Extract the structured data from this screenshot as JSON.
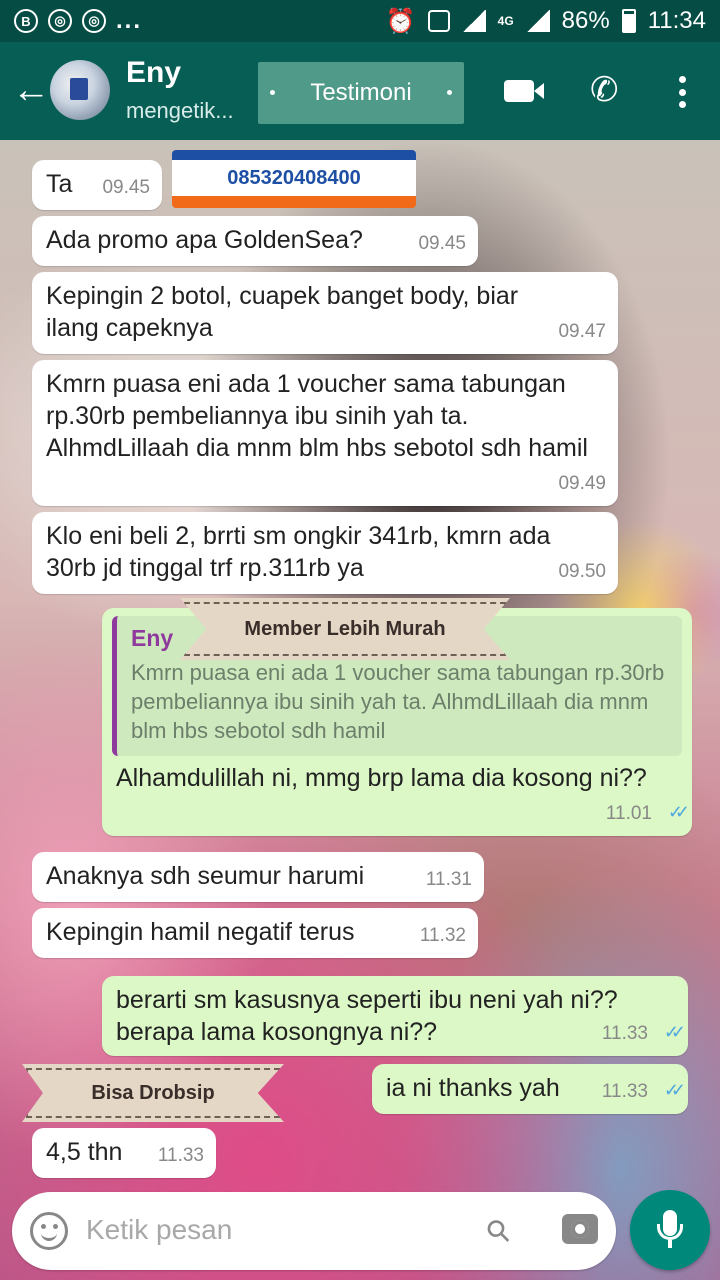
{
  "status_bar": {
    "icons_left": [
      "b-icon",
      "chrome-icon",
      "chrome-icon"
    ],
    "overflow": "...",
    "network": "4G",
    "battery": "86%",
    "time": "11:34"
  },
  "header": {
    "contact_name": "Eny",
    "contact_status": "mengetik...",
    "banner": "Testimoni"
  },
  "overlays": {
    "phone_number": "085320408400",
    "tag_member": "Member Lebih Murah",
    "tag_drobsip": "Bisa Drobsip"
  },
  "messages": [
    {
      "dir": "in",
      "text": "Ta",
      "time": "09.45"
    },
    {
      "dir": "in",
      "text": "Ada promo apa GoldenSea?",
      "time": "09.45"
    },
    {
      "dir": "in",
      "text": "Kepingin 2 botol, cuapek banget body, biar ilang capeknya",
      "time": "09.47"
    },
    {
      "dir": "in",
      "text": "Kmrn puasa eni ada 1 voucher sama tabungan rp.30rb pembeliannya ibu sinih yah ta. AlhmdLillaah dia mnm blm hbs sebotol sdh hamil",
      "time": "09.49"
    },
    {
      "dir": "in",
      "text": "Klo eni beli 2, brrti sm ongkir 341rb, kmrn ada 30rb jd tinggal trf rp.311rb ya",
      "time": "09.50"
    },
    {
      "dir": "out",
      "quote_name": "Eny",
      "quote_text": "Kmrn puasa eni ada 1 voucher sama tabungan rp.30rb pembeliannya ibu sinih yah ta. AlhmdLillaah dia mnm blm hbs sebotol sdh hamil",
      "text": "Alhamdulillah ni, mmg brp lama dia kosong ni??",
      "time": "11.01"
    },
    {
      "dir": "in",
      "text": "Anaknya sdh seumur harumi",
      "time": "11.31"
    },
    {
      "dir": "in",
      "text": "Kepingin hamil negatif terus",
      "time": "11.32"
    },
    {
      "dir": "out",
      "text": "berarti sm kasusnya seperti ibu neni yah ni?? berapa lama kosongnya ni??",
      "time": "11.33"
    },
    {
      "dir": "out",
      "text": "ia ni thanks yah",
      "time": "11.33"
    },
    {
      "dir": "in",
      "text": "4,5 thn",
      "time": "11.33"
    }
  ],
  "input": {
    "placeholder": "Ketik pesan"
  },
  "colors": {
    "header": "#075e54",
    "status_bar": "#054d44",
    "outgoing_bubble": "#dcf8c6",
    "read_ticks": "#4fa8e0",
    "fab": "#00897b"
  }
}
